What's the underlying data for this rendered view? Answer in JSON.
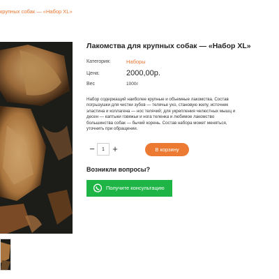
{
  "breadcrumb": {
    "text": "крупных собак — «Набор XL»"
  },
  "product": {
    "title": "Лакомства для крупных собак — «Набор XL»",
    "category_label": "Категория:",
    "category_value": "Наборы",
    "price_label": "Цена:",
    "price_value": "2000,00р.",
    "weight_label": "Вес",
    "weight_value": "1000г",
    "description": "Набор содержащий наиболее крупные и объемные лакомства. Состав погрызушки для чистки зубов — телячье ухо, становую жилу, источник эластина и коллагена — нос телячий; для укрепления челюстных мышц и десен — каптыки говяжьи и нога теленка и любимое лакомство большинства собак — бычий корень. Состав набора может меняться, уточнить при обращении."
  },
  "cart": {
    "minus": "−",
    "quantity": "1",
    "plus": "+",
    "add_to_cart_label": "В корзину"
  },
  "support": {
    "question_heading": "Возникли вопросы?",
    "consult_button_label": "Получите консультацию"
  },
  "colors": {
    "accent": "#ec7a33",
    "whatsapp_green": "#1fb546"
  },
  "icons": {
    "consult_icon": "whatsapp-icon"
  }
}
